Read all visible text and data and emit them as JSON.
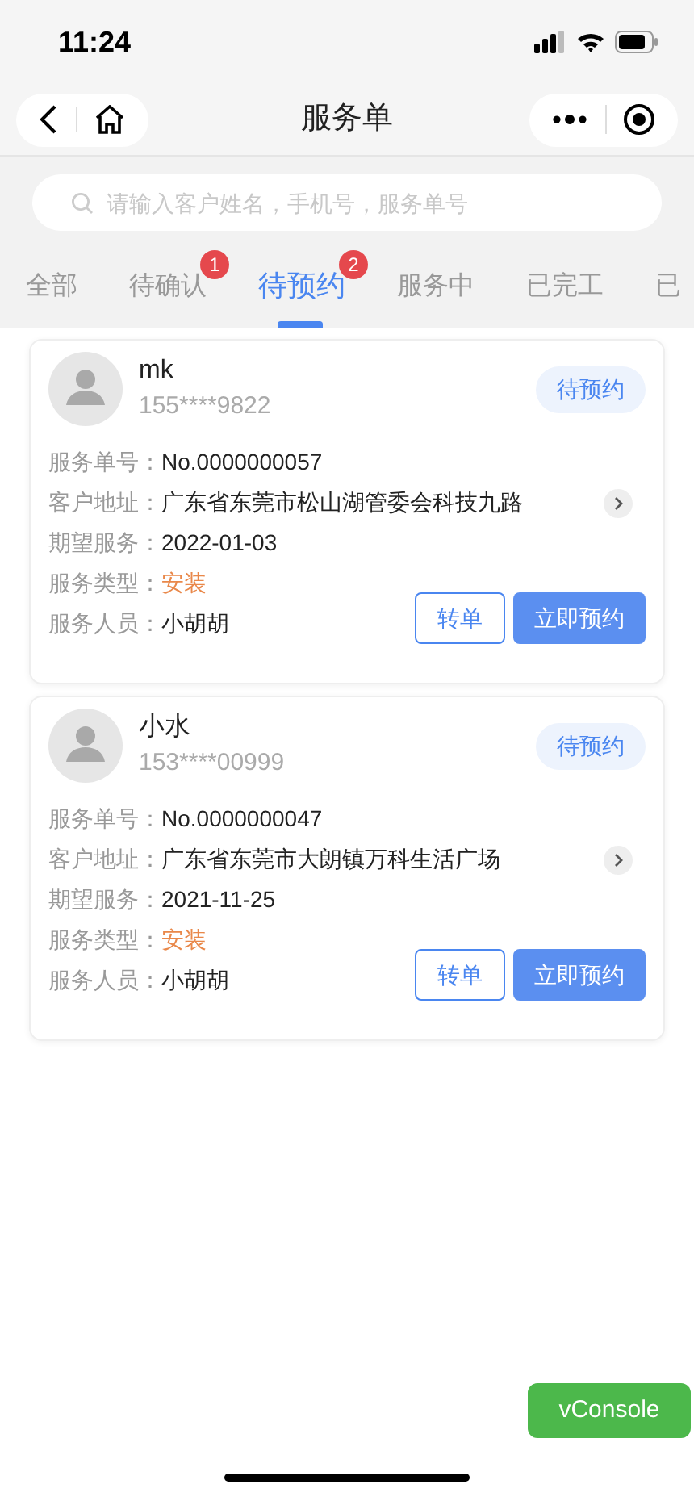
{
  "status_bar": {
    "time": "11:24"
  },
  "nav": {
    "title": "服务单"
  },
  "search": {
    "placeholder": "请输入客户姓名，手机号，服务单号"
  },
  "tabs": [
    {
      "label": "全部",
      "selected": false
    },
    {
      "label": "待确认",
      "selected": false,
      "badge": "1"
    },
    {
      "label": "待预约",
      "selected": true,
      "badge": "2"
    },
    {
      "label": "服务中",
      "selected": false
    },
    {
      "label": "已完工",
      "selected": false
    },
    {
      "label": "已",
      "selected": false
    }
  ],
  "orders": [
    {
      "name": "mk",
      "phone": "155****9822",
      "status": "待预约",
      "fields": [
        {
          "kind": "plain",
          "label": "服务单号：",
          "value": "No.0000000057"
        },
        {
          "kind": "address",
          "label": "客户地址：",
          "value": "广东省东莞市松山湖管委会科技九路"
        },
        {
          "kind": "plain",
          "label": "期望服务：",
          "value": "2022-01-03"
        },
        {
          "kind": "highlight",
          "label": "服务类型：",
          "value": "安装"
        },
        {
          "kind": "plain",
          "label": "服务人员：",
          "value": "小胡胡"
        }
      ],
      "buttons": [
        {
          "label": "转单",
          "kind": "outline"
        },
        {
          "label": "立即预约",
          "kind": "solid"
        }
      ]
    },
    {
      "name": "小水",
      "phone": "153****00999",
      "status": "待预约",
      "fields": [
        {
          "kind": "plain",
          "label": "服务单号：",
          "value": "No.0000000047"
        },
        {
          "kind": "address",
          "label": "客户地址：",
          "value": "广东省东莞市大朗镇万科生活广场"
        },
        {
          "kind": "plain",
          "label": "期望服务：",
          "value": "2021-11-25"
        },
        {
          "kind": "highlight",
          "label": "服务类型：",
          "value": "安装"
        },
        {
          "kind": "plain",
          "label": "服务人员：",
          "value": "小胡胡"
        }
      ],
      "buttons": [
        {
          "label": "转单",
          "kind": "outline"
        },
        {
          "label": "立即预约",
          "kind": "solid"
        }
      ]
    }
  ],
  "floating_button": {
    "label": "vConsole"
  }
}
